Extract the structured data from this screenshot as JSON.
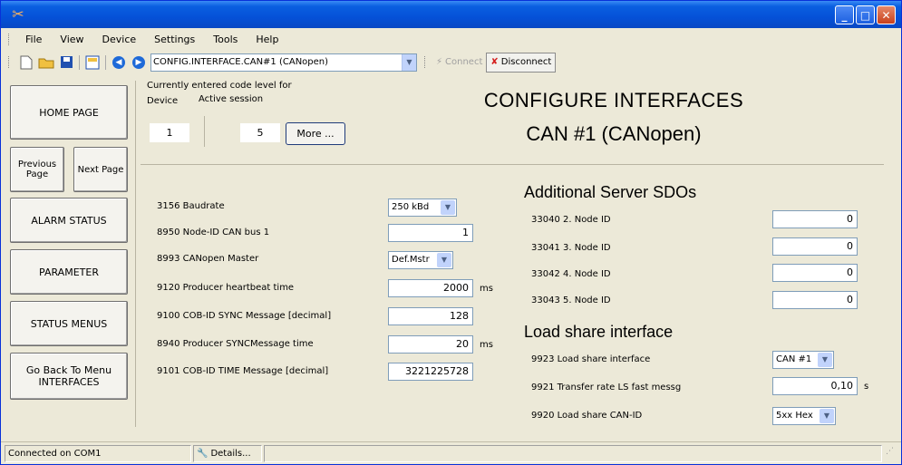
{
  "window": {
    "title": ""
  },
  "menu": [
    "File",
    "View",
    "Device",
    "Settings",
    "Tools",
    "Help"
  ],
  "toolbar": {
    "path": "CONFIG.INTERFACE.CAN#1 (CANopen)",
    "connect_label": "Connect",
    "disconnect_label": "Disconnect"
  },
  "nav": {
    "home": "HOME PAGE",
    "previous": "Previous Page",
    "next": "Next Page",
    "alarm": "ALARM STATUS",
    "parameter": "PARAMETER",
    "status_menus": "STATUS MENUS",
    "go_back": "Go Back To Menu INTERFACES"
  },
  "code_level": {
    "heading": "Currently entered code level for",
    "device_label": "Device",
    "session_label": "Active session",
    "device_value": "1",
    "session_value": "5",
    "more_label": "More ..."
  },
  "page": {
    "title": "CONFIGURE INTERFACES",
    "subtitle": "CAN #1 (CANopen)"
  },
  "params_left": [
    {
      "label": "3156 Baudrate",
      "value": "250 kBd",
      "type": "dropdown"
    },
    {
      "label": "8950 Node-ID CAN bus 1",
      "value": "1",
      "type": "field"
    },
    {
      "label": "8993 CANopen Master",
      "value": "Def.Mstr",
      "type": "dropdown"
    },
    {
      "label": "9120 Producer heartbeat time",
      "value": "2000",
      "unit": "ms",
      "type": "field"
    },
    {
      "label": "9100 COB-ID SYNC Message [decimal]",
      "value": "128",
      "type": "field"
    },
    {
      "label": "8940 Producer SYNCMessage time",
      "value": "20",
      "unit": "ms",
      "type": "field"
    },
    {
      "label": "9101 COB-ID TIME Message [decimal]",
      "value": "3221225728",
      "type": "field"
    }
  ],
  "sdo": {
    "title": "Additional Server SDOs",
    "items": [
      {
        "label": "33040 2. Node ID",
        "value": "0"
      },
      {
        "label": "33041 3. Node ID",
        "value": "0"
      },
      {
        "label": "33042 4. Node ID",
        "value": "0"
      },
      {
        "label": "33043 5. Node ID",
        "value": "0"
      }
    ]
  },
  "loadshare": {
    "title": "Load share interface",
    "items": [
      {
        "label": "9923 Load share interface",
        "value": "CAN #1",
        "type": "dropdown"
      },
      {
        "label": "9921 Transfer rate LS fast messg",
        "value": "0,10",
        "unit": "s",
        "type": "field"
      },
      {
        "label": "9920 Load share CAN-ID",
        "value": "5xx Hex",
        "type": "dropdown"
      }
    ]
  },
  "status": {
    "connection": "Connected on COM1",
    "details_label": "Details..."
  },
  "colors": {
    "titlebar": "#0551d8",
    "face": "#ece9d8",
    "field_border": "#7f9db9",
    "disconnect_icon": "#d42020"
  }
}
